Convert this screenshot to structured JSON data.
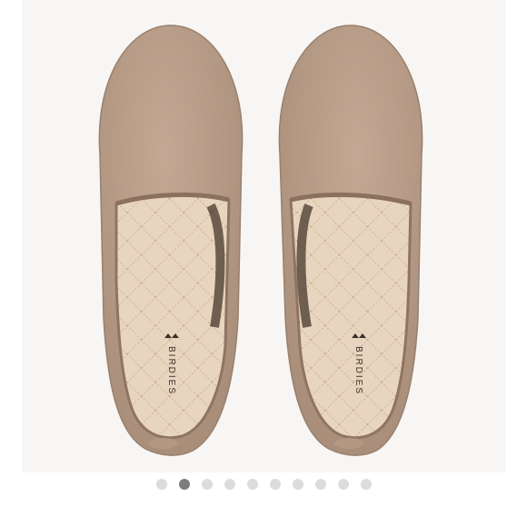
{
  "product_image": {
    "alt": "",
    "insole_brand": "BIRDIES"
  },
  "carousel": {
    "total": 10,
    "active_index": 1
  },
  "colors": {
    "background": "#f7f6f5",
    "suede": "#b59a86",
    "insole": "#e6d2bb",
    "dot_inactive": "#dcdcdc",
    "dot_active": "#7d7d7d"
  }
}
